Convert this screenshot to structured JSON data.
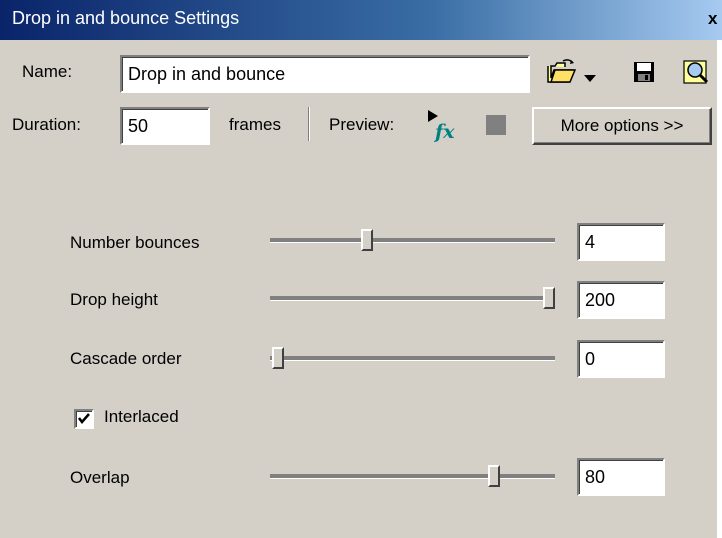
{
  "window": {
    "title": "Drop in and bounce Settings",
    "close_glyph": "x"
  },
  "header": {
    "name_label": "Name:",
    "name_value": "Drop in and bounce",
    "duration_label": "Duration:",
    "duration_value": "50",
    "frames_label": "frames",
    "preview_label": "Preview:",
    "more_options_label": "More options >>"
  },
  "icons": [
    "open-folder-icon",
    "dropdown-arrow-icon",
    "save-icon",
    "find-icon",
    "preview-fx-icon",
    "stop-icon"
  ],
  "settings": {
    "number_bounces": {
      "label": "Number bounces",
      "value": "4",
      "slider_fraction": 0.34
    },
    "drop_height": {
      "label": "Drop height",
      "value": "200",
      "slider_fraction": 1.0
    },
    "cascade_order": {
      "label": "Cascade order",
      "value": "0",
      "slider_fraction": 0.0
    },
    "interlaced": {
      "label": "Interlaced",
      "checked": true
    },
    "overlap": {
      "label": "Overlap",
      "value": "80",
      "slider_fraction": 0.8
    }
  },
  "colors": {
    "face": "#d4d0c8",
    "titlebar_start": "#0a246a",
    "titlebar_end": "#a6caf0",
    "title_text": "#ffffff"
  }
}
